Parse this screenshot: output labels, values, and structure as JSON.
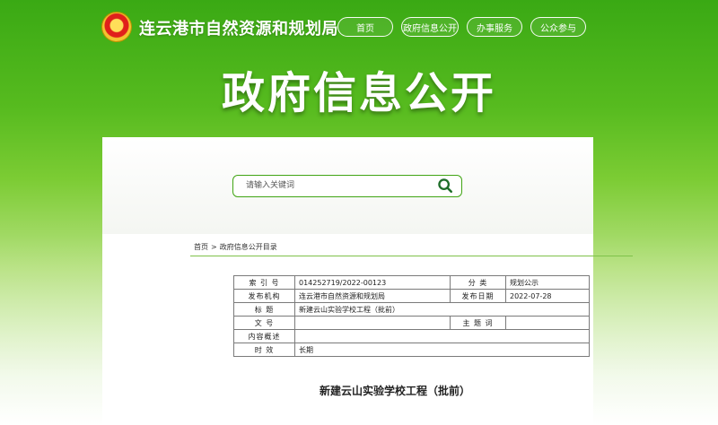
{
  "header": {
    "site_title": "连云港市自然资源和规划局",
    "nav": [
      "首页",
      "政府信息公开",
      "办事服务",
      "公众参与"
    ]
  },
  "hero": {
    "title": "政府信息公开"
  },
  "search": {
    "placeholder": "请输入关键词"
  },
  "breadcrumb": {
    "home": "首页",
    "separator": ">",
    "current": "政府信息公开目录"
  },
  "meta_table": {
    "rows": [
      {
        "k1": "索 引 号",
        "v1": "014252719/2022-00123",
        "k2": "分  类",
        "v2": "规划公示"
      },
      {
        "k1": "发布机构",
        "v1": "连云港市自然资源和规划局",
        "k2": "发布日期",
        "v2": "2022-07-28"
      },
      {
        "k1": "标  题",
        "v1": "新建云山实验学校工程（批前）"
      },
      {
        "k1": "文  号",
        "v1": "",
        "k2": "主 题 词",
        "v2": ""
      },
      {
        "k1": "内容概述",
        "v1": ""
      },
      {
        "k1": "时  效",
        "v1": "长期"
      }
    ]
  },
  "document": {
    "title": "新建云山实验学校工程（批前）"
  },
  "colors": {
    "brand_green": "#41a514",
    "nav_border": "#ffffff"
  },
  "icons": {
    "emblem": "national-emblem-icon",
    "search": "search-icon"
  }
}
